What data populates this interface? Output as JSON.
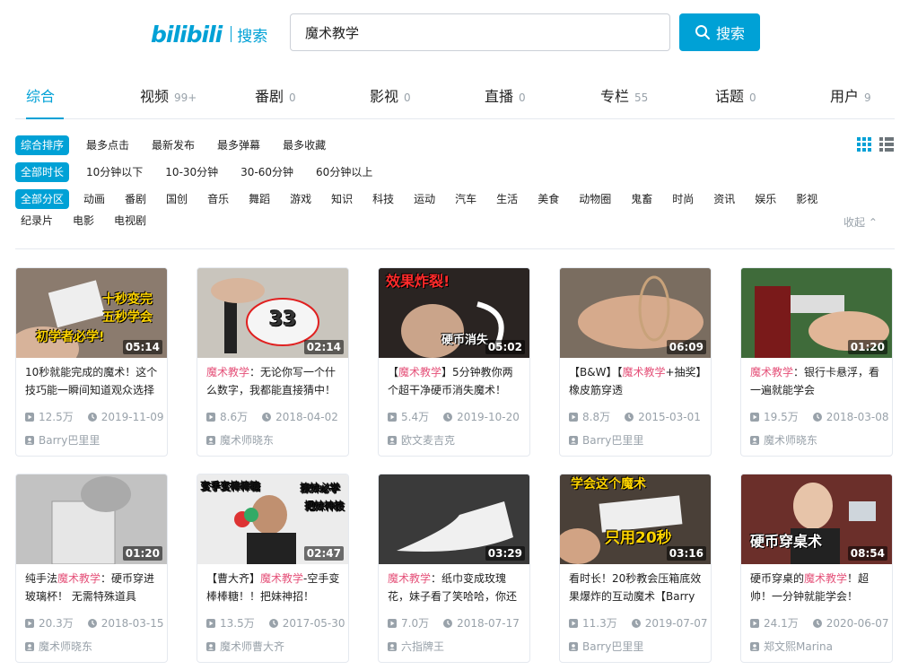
{
  "header": {
    "logo": "bilibili",
    "section": "搜索",
    "search_value": "魔术教学",
    "search_button": "搜索"
  },
  "type_tabs": [
    {
      "label": "综合",
      "count": "",
      "active": true
    },
    {
      "label": "视频",
      "count": "99+"
    },
    {
      "label": "番剧",
      "count": "0"
    },
    {
      "label": "影视",
      "count": "0"
    },
    {
      "label": "直播",
      "count": "0"
    },
    {
      "label": "专栏",
      "count": "55"
    },
    {
      "label": "话题",
      "count": "0"
    },
    {
      "label": "用户",
      "count": "9"
    }
  ],
  "filters": {
    "order": [
      "综合排序",
      "最多点击",
      "最新发布",
      "最多弹幕",
      "最多收藏"
    ],
    "duration": [
      "全部时长",
      "10分钟以下",
      "10-30分钟",
      "30-60分钟",
      "60分钟以上"
    ],
    "zones": [
      "全部分区",
      "动画",
      "番剧",
      "国创",
      "音乐",
      "舞蹈",
      "游戏",
      "知识",
      "科技",
      "运动",
      "汽车",
      "生活",
      "美食",
      "动物圈",
      "鬼畜",
      "时尚",
      "资讯",
      "娱乐",
      "影视"
    ],
    "zones_row2": [
      "纪录片",
      "电影",
      "电视剧"
    ],
    "collapse": "收起"
  },
  "accent": "#00a1d6",
  "highlight": "#e5527a",
  "videos": [
    {
      "title_pre": "10秒就能完成的魔术！这个技巧能一瞬间知道观众选择",
      "kw": "",
      "title_post": "",
      "plays": "12.5万",
      "date": "2019-11-09",
      "author": "Barry巴里里",
      "duration": "05:14",
      "thumb_text": [
        "十秒变完",
        "五秒学会",
        "初学者必学!"
      ],
      "bg": "#7a6a5e"
    },
    {
      "title_pre": "",
      "kw": "魔术教学",
      "title_post": "：无论你写一个什么数字，我都能直接猜中！",
      "plays": "8.6万",
      "date": "2018-04-02",
      "author": "魔术师晓东",
      "duration": "02:14",
      "thumb_text": [
        "33"
      ],
      "bg": "#b9b5ad"
    },
    {
      "title_pre": "【",
      "kw": "魔术教学",
      "title_post": "】5分钟教你两个超干净硬币消失魔术！",
      "plays": "5.4万",
      "date": "2019-10-20",
      "author": "欧文麦吉克",
      "duration": "05:02",
      "thumb_text": [
        "效果炸裂!",
        "硬币消失"
      ],
      "bg": "#2a2422"
    },
    {
      "title_pre": "【B&W】【",
      "kw": "魔术教学",
      "title_post": "+抽奖】橡皮筋穿透",
      "plays": "8.8万",
      "date": "2015-03-01",
      "author": "Barry巴里里",
      "duration": "06:09",
      "thumb_text": [],
      "bg": "#6d6256"
    },
    {
      "title_pre": "",
      "kw": "魔术教学",
      "title_post": "：银行卡悬浮，看一遍就能学会",
      "plays": "19.5万",
      "date": "2018-03-08",
      "author": "魔术师晓东",
      "duration": "01:20",
      "thumb_text": [],
      "bg": "#3f6b3a"
    },
    {
      "title_pre": "纯手法",
      "kw": "魔术教学",
      "title_post": "：硬币穿进玻璃杯！ 无需特殊道具",
      "plays": "20.3万",
      "date": "2018-03-15",
      "author": "魔术师晓东",
      "duration": "01:20",
      "thumb_text": [],
      "bg": "#bdbdbd"
    },
    {
      "title_pre": "【曹大齐】",
      "kw": "魔术教学",
      "title_post": "-空手变棒棒糖！！把妹神招！",
      "plays": "13.5万",
      "date": "2017-05-30",
      "author": "魔术师曹大齐",
      "duration": "02:47",
      "thumb_text": [
        "变手变棒棒糖",
        "撩妹必学",
        "把妹神技"
      ],
      "bg": "#e9e9e9"
    },
    {
      "title_pre": "",
      "kw": "魔术教学",
      "title_post": "：纸巾变成玫瑰花，妹子看了笑哈哈，你还",
      "plays": "7.0万",
      "date": "2018-07-17",
      "author": "六指牌王",
      "duration": "03:29",
      "thumb_text": [],
      "bg": "#3a3a3a"
    },
    {
      "title_pre": "看时长！20秒教会压箱底效果爆炸的互动魔术【Barry",
      "kw": "",
      "title_post": "",
      "plays": "11.3万",
      "date": "2019-07-07",
      "author": "Barry巴里里",
      "duration": "03:16",
      "thumb_text": [
        "学会这个魔术",
        "只用20秒"
      ],
      "bg": "#4a4038"
    },
    {
      "title_pre": "硬币穿桌的",
      "kw": "魔术教学",
      "title_post": "！超帅！一分钟就能学会！",
      "plays": "24.1万",
      "date": "2020-06-07",
      "author": "郑文熙Marina",
      "duration": "08:54",
      "thumb_text": [
        "硬币穿桌术"
      ],
      "bg": "#6b2f2a"
    }
  ]
}
